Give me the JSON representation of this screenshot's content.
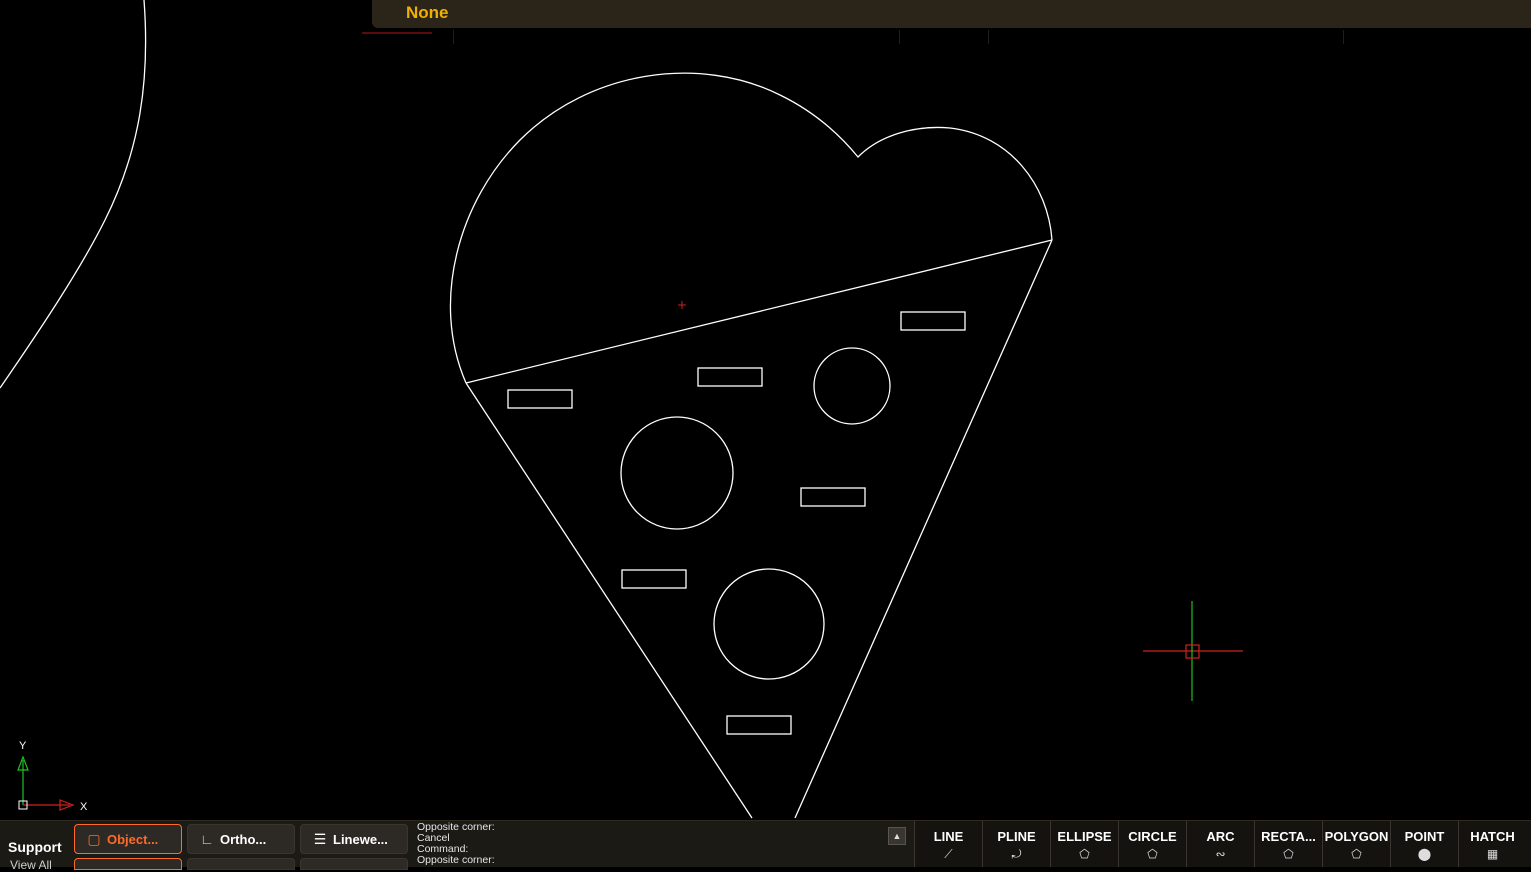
{
  "topbar": {
    "label": "None"
  },
  "ucs": {
    "y_label": "Y",
    "x_label": "X"
  },
  "bottombar": {
    "support_label": "Support",
    "support_sub": "View All",
    "toggles": [
      {
        "label": "Object...",
        "icon": "object-snap-icon",
        "active": true
      },
      {
        "label": "Ortho...",
        "icon": "ortho-icon",
        "active": false
      },
      {
        "label": "Linewe...",
        "icon": "lineweight-icon",
        "active": false
      }
    ],
    "command_log": [
      "Opposite corner:",
      "Cancel",
      "Command:",
      "Opposite corner:"
    ],
    "tools": [
      {
        "label": "LINE",
        "icon": "line-icon"
      },
      {
        "label": "PLINE",
        "icon": "polyline-icon"
      },
      {
        "label": "ELLIPSE",
        "icon": "ellipse-icon"
      },
      {
        "label": "CIRCLE",
        "icon": "circle-icon"
      },
      {
        "label": "ARC",
        "icon": "arc-icon"
      },
      {
        "label": "RECTA...",
        "icon": "rectangle-icon"
      },
      {
        "label": "POLYGON",
        "icon": "polygon-icon"
      },
      {
        "label": "POINT",
        "icon": "point-icon"
      },
      {
        "label": "HATCH",
        "icon": "hatch-icon"
      }
    ]
  },
  "colors": {
    "accent": "#f0b000",
    "active_toggle": "#ff6a2a",
    "crosshair_h": "#d02020",
    "crosshair_v": "#20c020"
  }
}
